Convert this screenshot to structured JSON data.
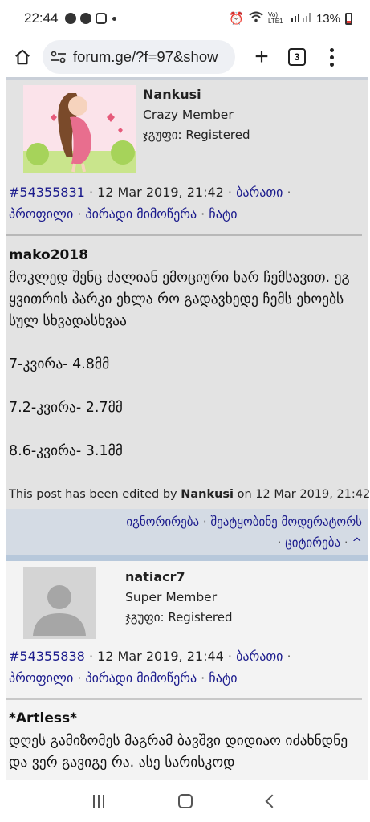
{
  "status_bar": {
    "time": "22:44",
    "battery": "13%",
    "signal_label": "Vo) LTE1"
  },
  "browser": {
    "url": "forum.ge/?f=97&show",
    "tab_count": "3"
  },
  "post1": {
    "username": "Nankusi",
    "role": "Crazy Member",
    "group": "ჯგუფი: Registered",
    "post_id": "#54355831",
    "datetime": "12 Mar 2019, 21:42",
    "link_karma": "ბარათი",
    "link_profile": "პროფილი",
    "link_pm": "პირადი მიმოწერა",
    "link_chat": "ჩატი",
    "quote_author": "mako2018",
    "text": "მოკლედ შენც ძალიან ემოციური ხარ ჩემსავით. ეგ ყვითრის პარკი ეხლა რო გადავხედე ჩემს ეხოებს სულ სხვადასხვაა",
    "line1": "7-კვირა- 4.8მმ",
    "line2": "7.2-კვირა- 2.7მმ",
    "line3": "8.6-კვირა- 3.1მმ",
    "edited_prefix": "This post has been edited by",
    "edited_by": "Nankusi",
    "edited_suffix": "on 12 Mar 2019, 21:42",
    "action_ignore": "იგნორირება",
    "action_report": "შეატყობინე მოდერატორს",
    "action_quote": "ციტირება",
    "action_top": "^"
  },
  "post2": {
    "username": "natiacr7",
    "role": "Super Member",
    "group": "ჯგუფი: Registered",
    "post_id": "#54355838",
    "datetime": "12 Mar 2019, 21:44",
    "link_karma": "ბარათი",
    "link_profile": "პროფილი",
    "link_pm": "პირადი მიმოწერა",
    "link_chat": "ჩატი",
    "quote_author": "*Artless*",
    "text": "დღეს გამიზომეს მაგრამ ბავშვი დიდიაო იძახნდნე და ვერ გავიგე რა. ასე სარისკოდ"
  },
  "colors": {
    "link": "#1a1a8c",
    "post_bg": "#e3e3e3",
    "footer_bg": "#d4dbe4",
    "separator": "#b7c8db"
  }
}
